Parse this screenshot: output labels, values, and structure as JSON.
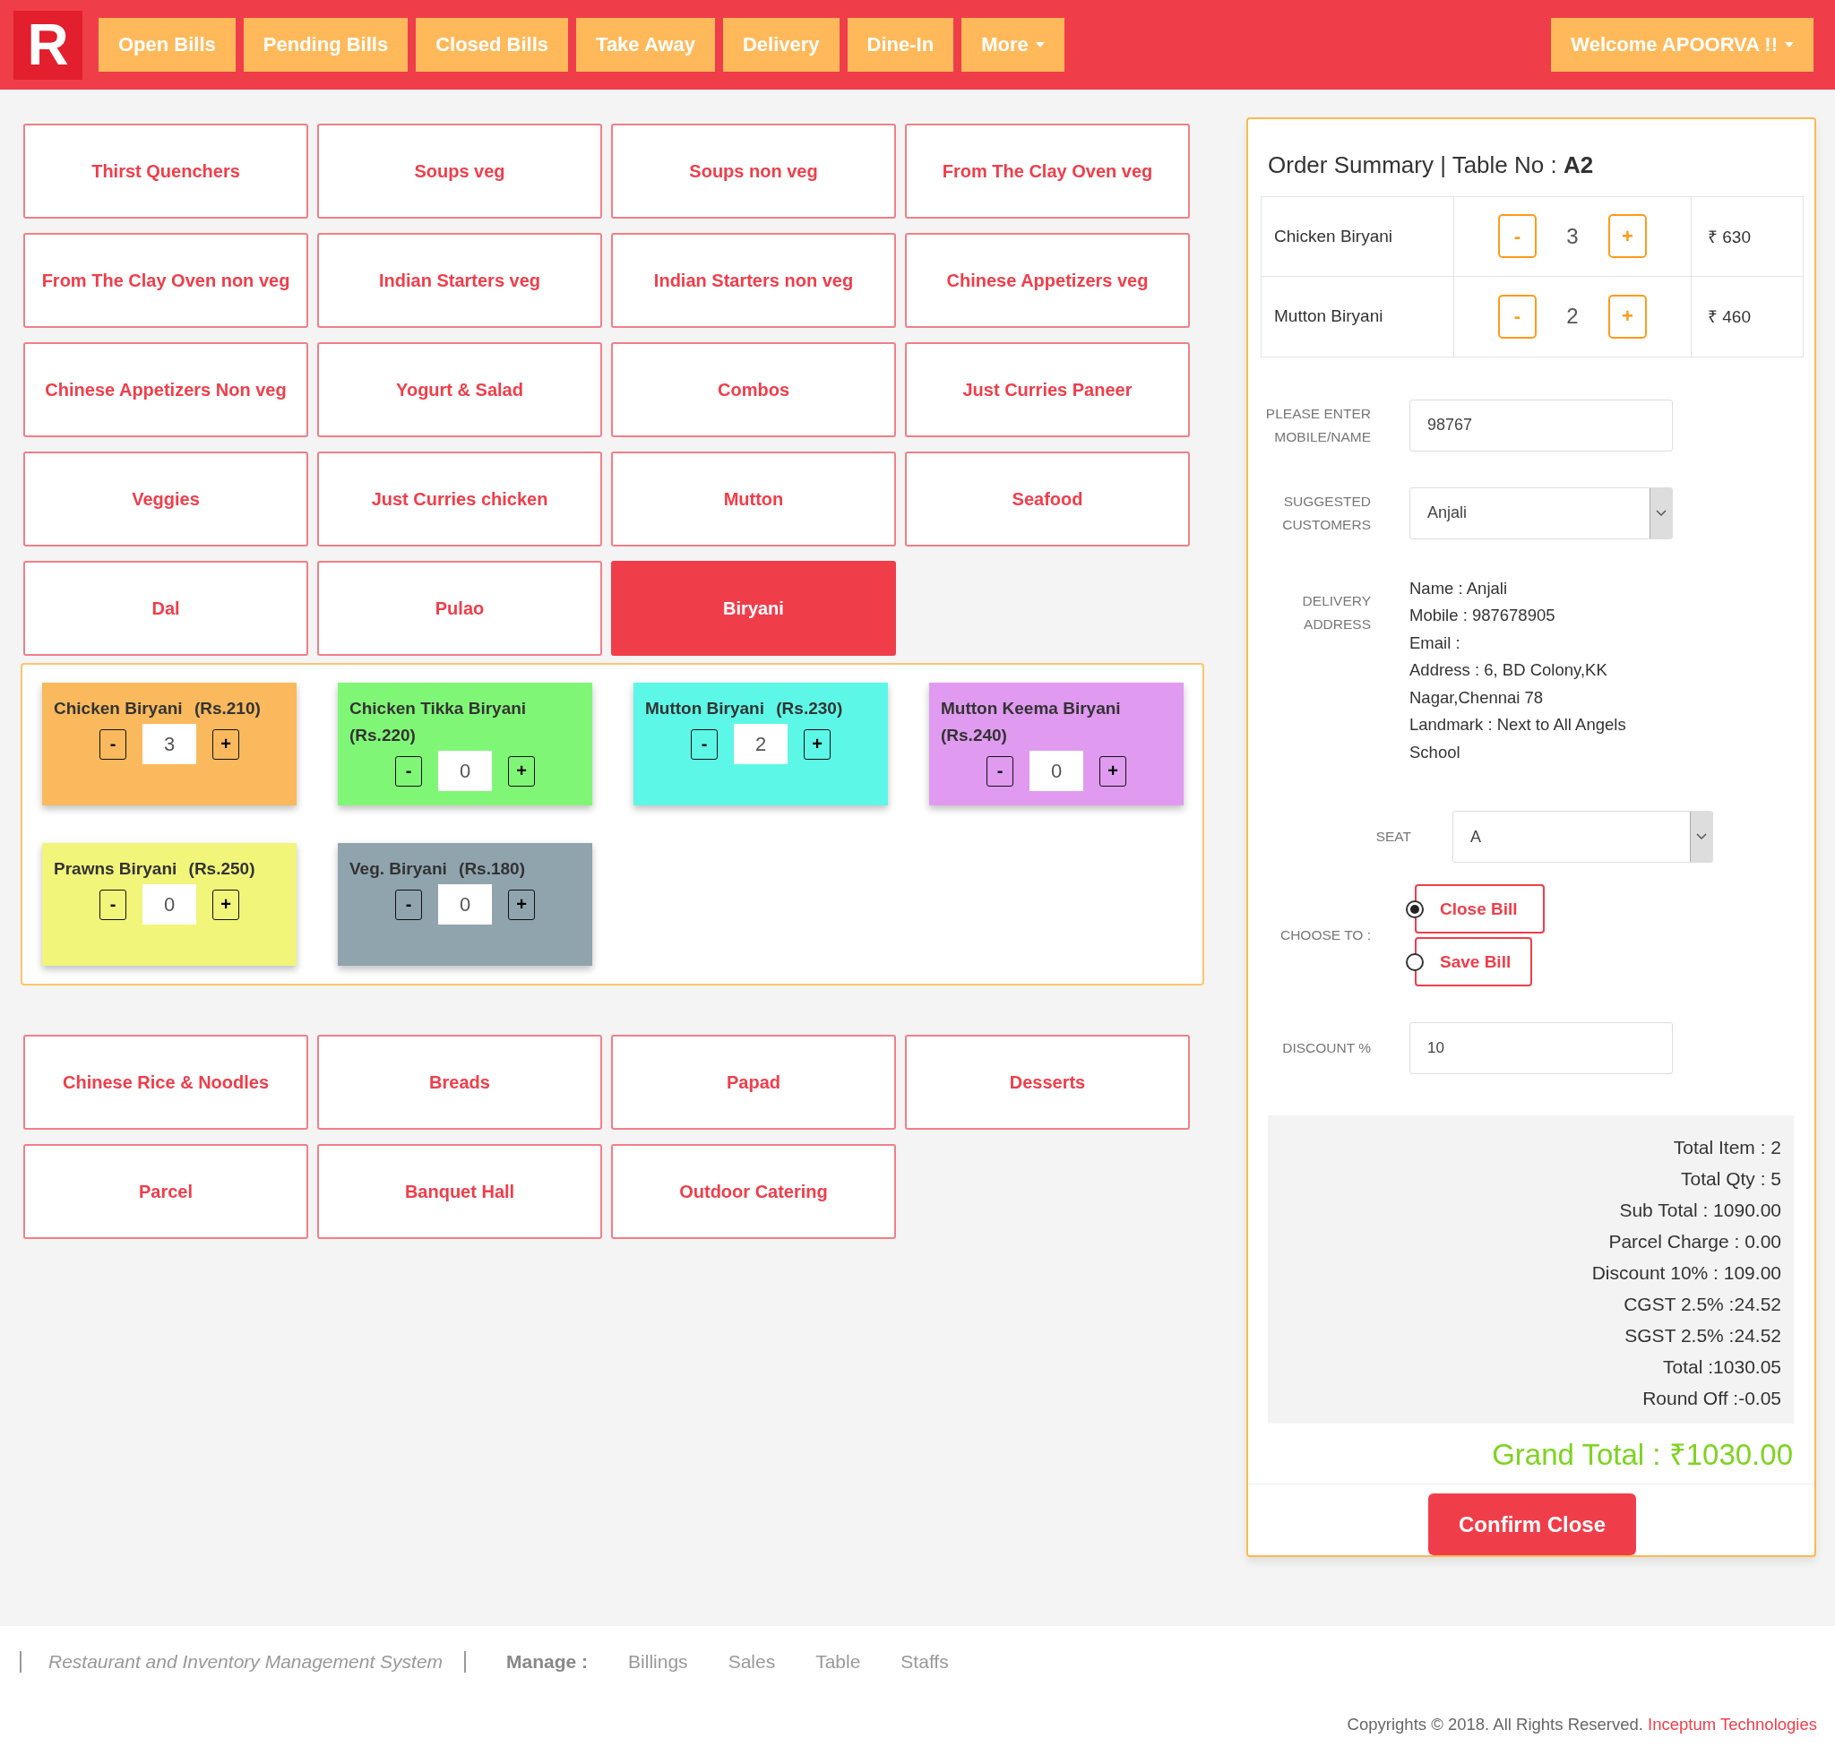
{
  "header": {
    "logo": "R",
    "tabs": [
      {
        "label": "Open Bills",
        "kind": "plain"
      },
      {
        "label": "Pending Bills",
        "kind": "plain"
      },
      {
        "label": "Closed Bills",
        "kind": "plain"
      },
      {
        "label": "Take Away",
        "kind": "plain"
      },
      {
        "label": "Delivery",
        "kind": "plain"
      },
      {
        "label": "Dine-In",
        "kind": "plain"
      },
      {
        "label": "More",
        "kind": "dropdown"
      }
    ],
    "user_menu": "Welcome APOORVA !!"
  },
  "categories_top": [
    {
      "label": "Thirst Quenchers",
      "selected": false
    },
    {
      "label": "Soups veg",
      "selected": false
    },
    {
      "label": "Soups non veg",
      "selected": false
    },
    {
      "label": "From The Clay Oven veg",
      "selected": false
    },
    {
      "label": "From The Clay Oven non veg",
      "selected": false
    },
    {
      "label": "Indian Starters veg",
      "selected": false
    },
    {
      "label": "Indian Starters non veg",
      "selected": false
    },
    {
      "label": "Chinese Appetizers veg",
      "selected": false
    },
    {
      "label": "Chinese Appetizers Non veg",
      "selected": false
    },
    {
      "label": "Yogurt & Salad",
      "selected": false
    },
    {
      "label": "Combos",
      "selected": false
    },
    {
      "label": "Just Curries Paneer",
      "selected": false
    },
    {
      "label": "Veggies",
      "selected": false
    },
    {
      "label": "Just Curries chicken",
      "selected": false
    },
    {
      "label": "Mutton",
      "selected": false
    },
    {
      "label": "Seafood",
      "selected": false
    },
    {
      "label": "Dal",
      "selected": false
    },
    {
      "label": "Pulao",
      "selected": false
    },
    {
      "label": "Biryani",
      "selected": true
    }
  ],
  "menu_items": [
    {
      "name": "Chicken Biryani",
      "price": "(Rs.210)",
      "minus": "-",
      "qty": "3",
      "plus": "+",
      "color": "#f9b95c"
    },
    {
      "name": "Chicken Tikka Biryani",
      "price": "(Rs.220)",
      "minus": "-",
      "qty": "0",
      "plus": "+",
      "color": "#80f676"
    },
    {
      "name": "Mutton Biryani",
      "price": "(Rs.230)",
      "minus": "-",
      "qty": "2",
      "plus": "+",
      "color": "#5cf7e6"
    },
    {
      "name": "Mutton Keema Biryani",
      "price": "(Rs.240)",
      "minus": "-",
      "qty": "0",
      "plus": "+",
      "color": "#e09af0"
    },
    {
      "name": "Prawns Biryani",
      "price": "(Rs.250)",
      "minus": "-",
      "qty": "0",
      "plus": "+",
      "color": "#f1f57a"
    },
    {
      "name": "Veg. Biryani",
      "price": "(Rs.180)",
      "minus": "-",
      "qty": "0",
      "plus": "+",
      "color": "#90a4ae"
    }
  ],
  "categories_bottom": [
    {
      "label": "Chinese Rice & Noodles",
      "selected": false
    },
    {
      "label": "Breads",
      "selected": false
    },
    {
      "label": "Papad",
      "selected": false
    },
    {
      "label": "Desserts",
      "selected": false
    },
    {
      "label": "Parcel",
      "selected": false
    },
    {
      "label": "Banquet Hall",
      "selected": false
    },
    {
      "label": "Outdoor Catering",
      "selected": false
    }
  ],
  "order_summary": {
    "title": "Order Summary | Table No : **A2**",
    "lines": [
      {
        "name": "Chicken Biryani",
        "minus": "-",
        "qty": "3",
        "plus": "+",
        "amount": "₹ 630"
      },
      {
        "name": "Mutton Biryani",
        "minus": "-",
        "qty": "2",
        "plus": "+",
        "amount": "₹ 460"
      }
    ],
    "mobile": {
      "label": "PLEASE ENTER MOBILE/NAME",
      "value": "98767"
    },
    "suggested": {
      "label": "SUGGESTED CUSTOMERS",
      "value": "Anjali"
    },
    "delivery": {
      "label": "DELIVERY ADDRESS",
      "lines": [
        "Name : Anjali",
        "Mobile : 987678905",
        "Email :",
        "Address : 6, BD Colony,KK Nagar,Chennai 78",
        "Landmark : Next to All Angels School"
      ]
    },
    "seat": {
      "label": "SEAT",
      "value": "A"
    },
    "choose": {
      "label": "CHOOSE TO :",
      "options": [
        {
          "label": "Close Bill",
          "selected": true
        },
        {
          "label": "Save Bill",
          "selected": false
        }
      ]
    },
    "discount": {
      "label": "DISCOUNT %",
      "value": "10"
    },
    "totals": [
      "Total Item : 2",
      "Total Qty : 5",
      "Sub Total : 1090.00",
      "Parcel Charge : 0.00",
      "Discount 10% : 109.00",
      "CGST 2.5% :24.52",
      "SGST 2.5% :24.52",
      "Total :1030.05",
      "Round Off :-0.05"
    ],
    "grand_total": "Grand Total : ₹1030.00",
    "confirm": "Confirm Close"
  },
  "footer": {
    "app_name": "Restaurant and Inventory Management System",
    "manage_label": "Manage :",
    "links": [
      "Billings",
      "Sales",
      "Table",
      "Staffs"
    ],
    "copyright": "Copyrights © 2018. All Rights Reserved.",
    "company": "Inceptum Technologies"
  }
}
